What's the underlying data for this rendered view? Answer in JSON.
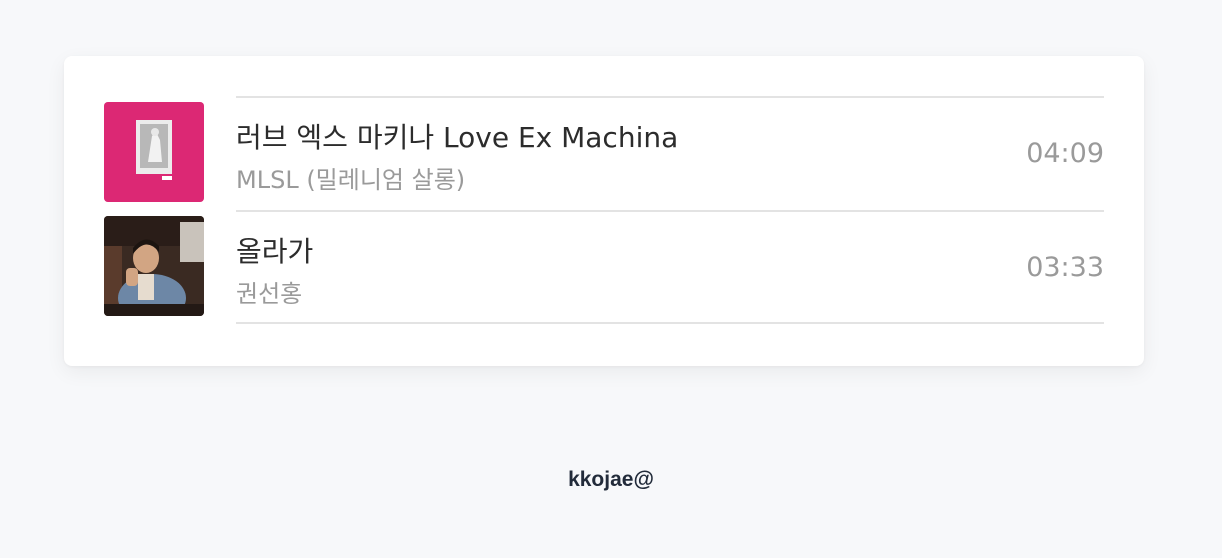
{
  "tracks": [
    {
      "title": "러브 엑스 마키나 Love Ex Machina",
      "artist": "MLSL (밀레니엄 살롱)",
      "duration": "04:09",
      "cover_icon": "album-cover-pink-art",
      "cover_color": "#d9236f"
    },
    {
      "title": "올라가",
      "artist": "권선홍",
      "duration": "03:33",
      "cover_icon": "album-cover-portrait-photo",
      "cover_color": "#3a2a22"
    }
  ],
  "footer": {
    "text": "kkojae@"
  }
}
